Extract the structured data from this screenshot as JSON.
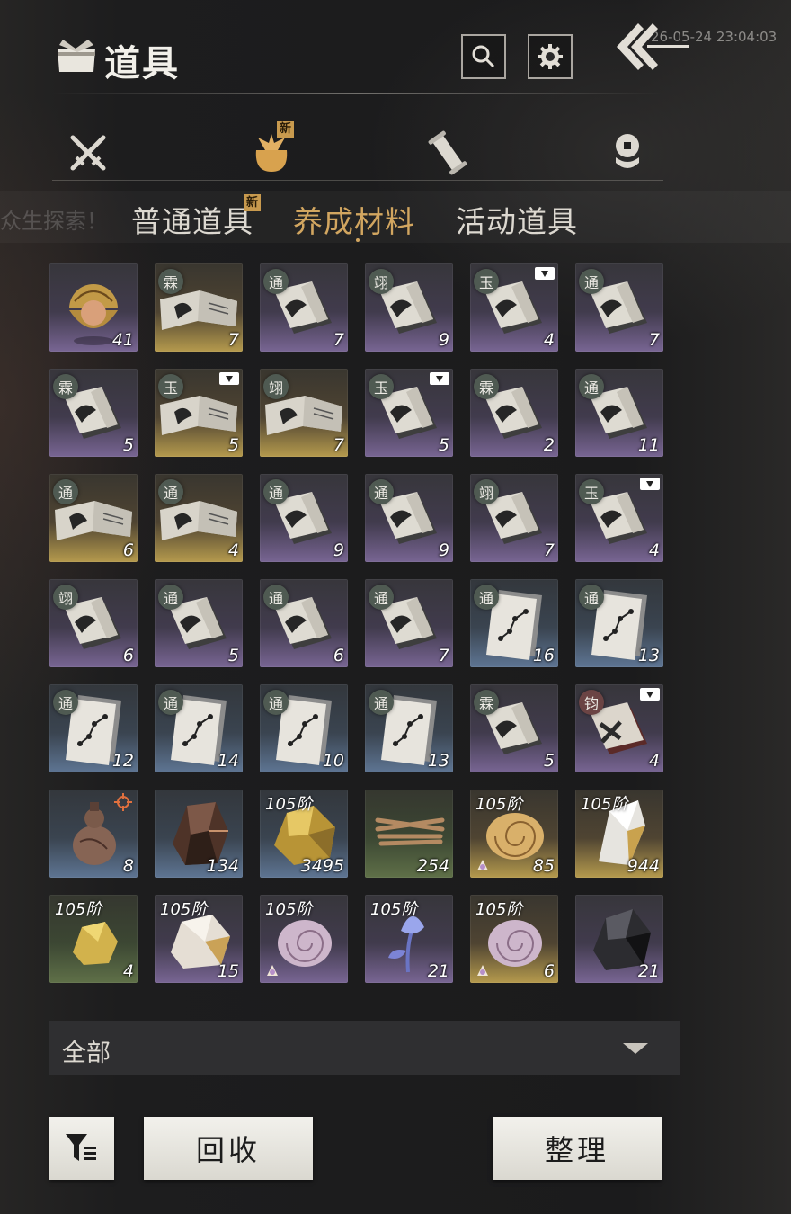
{
  "header": {
    "title": "道具",
    "datetime": "26-05-24 23:04:03",
    "icons": {
      "title": "pouch-icon",
      "search": "search-icon",
      "settings": "gear-icon",
      "back": "back-arrow-icon"
    }
  },
  "categories": [
    {
      "icon": "crossed-swords-icon",
      "active": false
    },
    {
      "icon": "pouch-icon",
      "active": true,
      "badge": "新"
    },
    {
      "icon": "scroll-icon",
      "active": false
    },
    {
      "icon": "coin-stack-icon",
      "active": false
    }
  ],
  "subtabs": [
    {
      "label": "普通道具",
      "badge": "新",
      "active": false
    },
    {
      "label": "养成材料",
      "active": true
    },
    {
      "label": "活动道具",
      "active": false
    }
  ],
  "background_text": "众生探索！",
  "colors": {
    "accent_gold": "#d2a660",
    "badge": "#c89a4e",
    "purple": "#786593",
    "gold": "#b59a4d",
    "blue": "#5e7593",
    "green": "#5f7048"
  },
  "items": [
    {
      "rarity": "purple",
      "count": "41",
      "art": "golden-orb"
    },
    {
      "rarity": "gold",
      "count": "7",
      "art": "open-manual",
      "tag": "霖"
    },
    {
      "rarity": "purple",
      "count": "7",
      "art": "manual",
      "tag": "通"
    },
    {
      "rarity": "purple",
      "count": "9",
      "art": "manual",
      "tag": "翊"
    },
    {
      "rarity": "purple",
      "count": "4",
      "art": "manual",
      "tag": "玉",
      "locked": true
    },
    {
      "rarity": "purple",
      "count": "7",
      "art": "manual",
      "tag": "通"
    },
    {
      "rarity": "purple",
      "count": "5",
      "art": "manual",
      "tag": "霖"
    },
    {
      "rarity": "gold",
      "count": "5",
      "art": "open-manual",
      "tag": "玉",
      "locked": true
    },
    {
      "rarity": "gold",
      "count": "7",
      "art": "open-manual",
      "tag": "翊"
    },
    {
      "rarity": "purple",
      "count": "5",
      "art": "manual",
      "tag": "玉",
      "locked": true
    },
    {
      "rarity": "purple",
      "count": "2",
      "art": "manual",
      "tag": "霖"
    },
    {
      "rarity": "purple",
      "count": "11",
      "art": "manual",
      "tag": "通"
    },
    {
      "rarity": "gold",
      "count": "6",
      "art": "open-manual",
      "tag": "通"
    },
    {
      "rarity": "gold",
      "count": "4",
      "art": "open-manual",
      "tag": "通"
    },
    {
      "rarity": "purple",
      "count": "9",
      "art": "manual",
      "tag": "通"
    },
    {
      "rarity": "purple",
      "count": "9",
      "art": "manual",
      "tag": "通"
    },
    {
      "rarity": "purple",
      "count": "7",
      "art": "manual",
      "tag": "翊"
    },
    {
      "rarity": "purple",
      "count": "4",
      "art": "manual",
      "tag": "玉",
      "locked": true
    },
    {
      "rarity": "purple",
      "count": "6",
      "art": "manual",
      "tag": "翊"
    },
    {
      "rarity": "purple",
      "count": "5",
      "art": "manual",
      "tag": "通"
    },
    {
      "rarity": "purple",
      "count": "6",
      "art": "manual",
      "tag": "通"
    },
    {
      "rarity": "purple",
      "count": "7",
      "art": "manual",
      "tag": "通"
    },
    {
      "rarity": "blue",
      "count": "16",
      "art": "meridian-chart",
      "tag": "通"
    },
    {
      "rarity": "blue",
      "count": "13",
      "art": "meridian-chart",
      "tag": "通"
    },
    {
      "rarity": "blue",
      "count": "12",
      "art": "meridian-chart",
      "tag": "通"
    },
    {
      "rarity": "blue",
      "count": "14",
      "art": "meridian-chart",
      "tag": "通"
    },
    {
      "rarity": "blue",
      "count": "10",
      "art": "meridian-chart",
      "tag": "通"
    },
    {
      "rarity": "blue",
      "count": "13",
      "art": "meridian-chart",
      "tag": "通"
    },
    {
      "rarity": "purple",
      "count": "5",
      "art": "manual",
      "tag": "霖"
    },
    {
      "rarity": "purple",
      "count": "4",
      "art": "red-manual",
      "tag": "钧",
      "tag_color": "red",
      "locked": true
    },
    {
      "rarity": "blue",
      "count": "8",
      "art": "gourd",
      "target": true
    },
    {
      "rarity": "blue",
      "count": "134",
      "art": "dark-ore"
    },
    {
      "rarity": "blue",
      "count": "3495",
      "art": "gold-ore",
      "tier": "105阶"
    },
    {
      "rarity": "green",
      "count": "254",
      "art": "wood-sticks"
    },
    {
      "rarity": "gold",
      "count": "85",
      "art": "conch-shell",
      "tier": "105阶",
      "mini": true
    },
    {
      "rarity": "gold",
      "count": "944",
      "art": "white-crystal",
      "tier": "105阶"
    },
    {
      "rarity": "green",
      "count": "4",
      "art": "gold-nugget",
      "tier": "105阶"
    },
    {
      "rarity": "purple",
      "count": "15",
      "art": "white-gold-ore",
      "tier": "105阶"
    },
    {
      "rarity": "purple",
      "count": "",
      "art": "spiral-shell",
      "tier": "105阶",
      "mini": true
    },
    {
      "rarity": "purple",
      "count": "21",
      "art": "blue-flower",
      "tier": "105阶"
    },
    {
      "rarity": "gold",
      "count": "6",
      "art": "spiral-shell",
      "tier": "105阶",
      "mini": true
    },
    {
      "rarity": "purple",
      "count": "21",
      "art": "black-ore"
    }
  ],
  "filter": {
    "label": "全部",
    "icon": "dropdown-arrow-icon"
  },
  "buttons": {
    "filter_icon": "filter-list-icon",
    "recycle": "回收",
    "sort": "整理"
  }
}
